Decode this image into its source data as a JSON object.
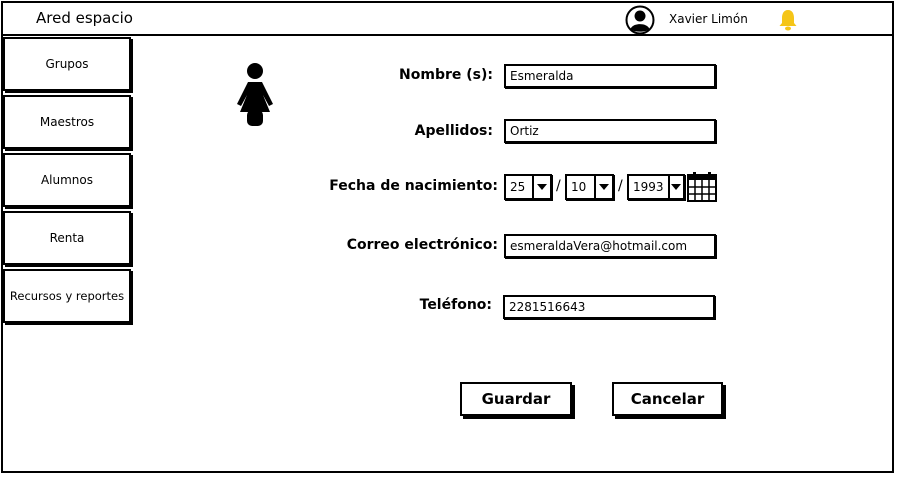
{
  "app": {
    "title": "Ared espacio"
  },
  "user": {
    "name": "Xavier Limón"
  },
  "sidebar": {
    "items": [
      {
        "label": "Grupos"
      },
      {
        "label": "Maestros"
      },
      {
        "label": "Alumnos"
      },
      {
        "label": "Renta"
      },
      {
        "label": "Recursos y reportes"
      }
    ]
  },
  "form": {
    "nombre": {
      "label": "Nombre (s):",
      "value": "Esmeralda"
    },
    "apellidos": {
      "label": "Apellidos:",
      "value": "Ortiz"
    },
    "fecha": {
      "label": "Fecha de nacimiento:",
      "day": "25",
      "month": "10",
      "year": "1993",
      "separator": "/"
    },
    "correo": {
      "label": "Correo electrónico:",
      "value": "esmeraldaVera@hotmail.com"
    },
    "telefono": {
      "label": "Teléfono:",
      "value": "2281516643"
    }
  },
  "actions": {
    "save_label": "Guardar",
    "cancel_label": "Cancelar"
  },
  "colors": {
    "bell": "#f5c518",
    "border": "#000000",
    "background": "#ffffff"
  },
  "icons": {
    "avatar": "user-circle-icon",
    "bell": "bell-icon",
    "person": "female-person-icon",
    "calendar": "calendar-icon",
    "dropdown": "chevron-down-icon"
  }
}
